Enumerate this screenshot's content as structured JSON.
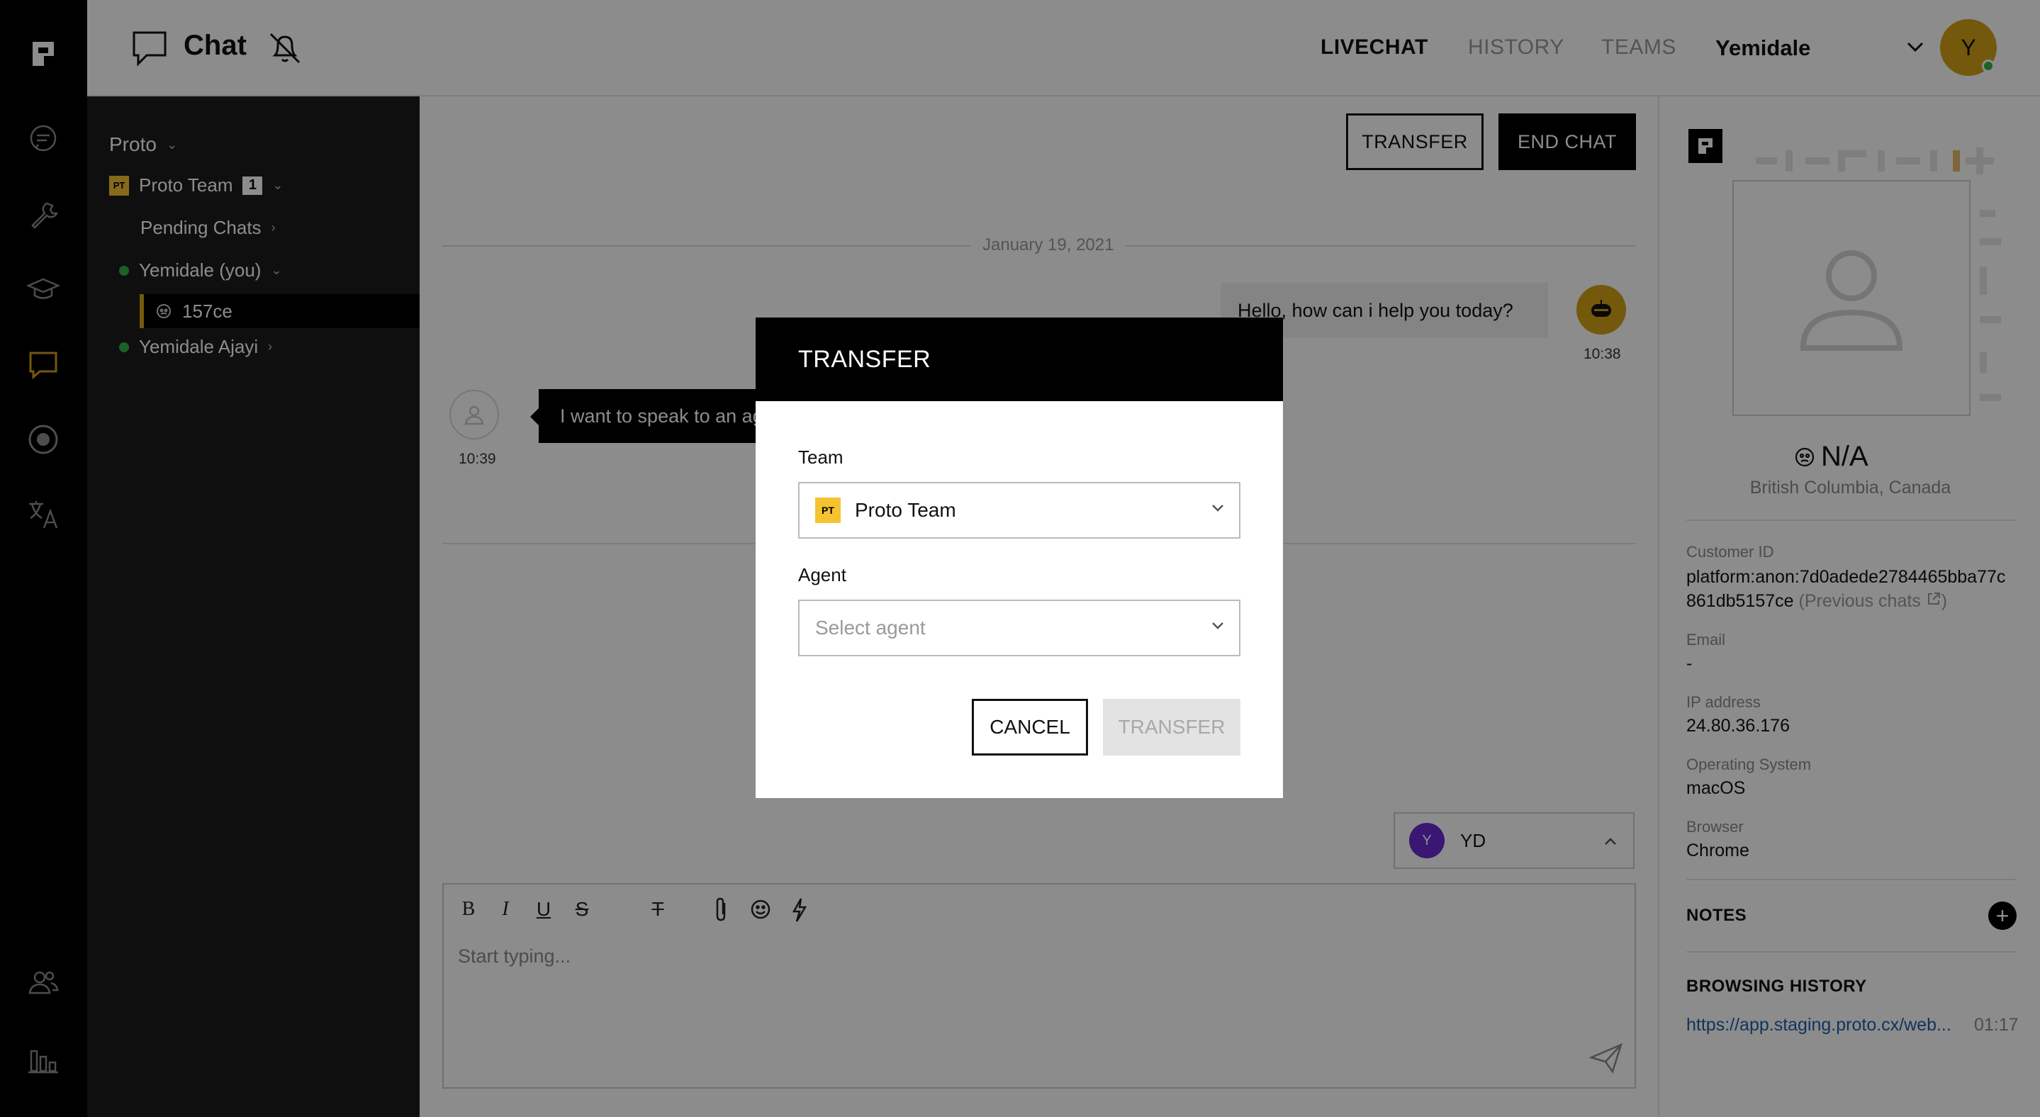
{
  "header": {
    "title": "Chat",
    "nav": [
      "LIVECHAT",
      "HISTORY",
      "TEAMS"
    ],
    "active_nav": "LIVECHAT",
    "user_name": "Yemidale",
    "user_initial": "Y"
  },
  "rail": {
    "icons": [
      "proto-logo-icon",
      "messaging-icon",
      "wrench-icon",
      "graduation-cap-icon",
      "chat-bubble-icon",
      "target-icon",
      "translate-icon",
      "users-icon",
      "analytics-icon"
    ],
    "active_icon": "chat-bubble-icon"
  },
  "tree": {
    "workspace": "Proto",
    "team_badge": "PT",
    "team": "Proto Team",
    "team_count": "1",
    "pending": "Pending Chats",
    "agent_self": "Yemidale (you)",
    "selected_chat": "157ce",
    "agent_other": "Yemidale Ajayi"
  },
  "chat": {
    "transfer_button": "TRANSFER",
    "end_chat_button": "END CHAT",
    "date": "January 19, 2021",
    "messages": [
      {
        "from": "bot",
        "text": "Hello, how can i help you today?",
        "time": "10:38"
      },
      {
        "from": "customer",
        "text": "I want to speak to an ag",
        "time": "10:39"
      }
    ],
    "assignee_initial": "Y",
    "assignee": "YD",
    "composer_placeholder": "Start typing...",
    "toolbar": {
      "bold": "B",
      "italic": "I",
      "underline": "U",
      "strike": "S",
      "clear_format": "T"
    }
  },
  "customer": {
    "name": "N/A",
    "location": "British Columbia, Canada",
    "customer_id_label": "Customer ID",
    "customer_id_line1": "platform:anon:7d0adede2784465bba77c",
    "customer_id_line2": "861db5157ce",
    "previous_chats": "(Previous chats",
    "previous_chats_close": ")",
    "email_label": "Email",
    "email": "-",
    "ip_label": "IP address",
    "ip": "24.80.36.176",
    "os_label": "Operating System",
    "os": "macOS",
    "browser_label": "Browser",
    "browser": "Chrome",
    "notes_title": "NOTES",
    "history_title": "BROWSING HISTORY",
    "history_link": "https://app.staging.proto.cx/web...",
    "history_time": "01:17"
  },
  "modal": {
    "title": "TRANSFER",
    "team_label": "Team",
    "team_badge": "PT",
    "team_value": "Proto Team",
    "agent_label": "Agent",
    "agent_placeholder": "Select agent",
    "cancel": "CANCEL",
    "transfer": "TRANSFER"
  },
  "colors": {
    "accent": "#d4a017",
    "badge_yellow": "#f5c230",
    "online": "#35b04a",
    "assignee_purple": "#6b2bd0",
    "link": "#1f5fa8"
  }
}
